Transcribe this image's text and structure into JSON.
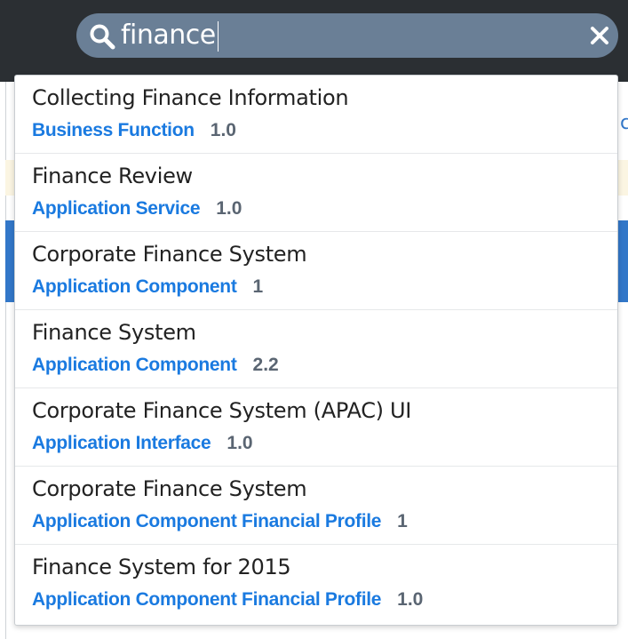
{
  "search": {
    "query": "finance"
  },
  "background": {
    "partial_glyph": "c"
  },
  "colors": {
    "topbar": "#2b2f33",
    "search_pill": "#6a7f96",
    "type_label": "#1a7ae0",
    "version_label": "#5a6572",
    "background_selection": "#3277c8"
  },
  "results": [
    {
      "title": "Collecting Finance Information",
      "type": "Business Function",
      "version": "1.0"
    },
    {
      "title": "Finance Review",
      "type": "Application Service",
      "version": "1.0"
    },
    {
      "title": "Corporate Finance System",
      "type": "Application Component",
      "version": "1"
    },
    {
      "title": "Finance System",
      "type": "Application Component",
      "version": "2.2"
    },
    {
      "title": "Corporate Finance System (APAC) UI",
      "type": "Application Interface",
      "version": "1.0"
    },
    {
      "title": "Corporate Finance System",
      "type": "Application Component Financial Profile",
      "version": "1"
    },
    {
      "title": "Finance System for 2015",
      "type": "Application Component Financial Profile",
      "version": "1.0"
    }
  ]
}
